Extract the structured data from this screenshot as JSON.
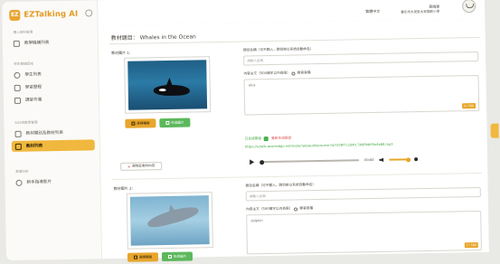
{
  "app": {
    "name": "EZTalking AI",
    "logo_text": "EZ"
  },
  "sidebar": {
    "sections": [
      {
        "title": "個人資料管理",
        "items": [
          {
            "label": "教學機構列表",
            "icon": "home-icon"
          }
        ]
      },
      {
        "title": "學生管理區域",
        "items": [
          {
            "label": "學生列表",
            "icon": "user-icon"
          },
          {
            "label": "學習歷程",
            "icon": "book-icon"
          },
          {
            "label": "課堂作業",
            "icon": "edit-icon"
          }
        ]
      },
      {
        "title": "AI口說教學管理",
        "items": [
          {
            "label": "教材類別及教材列表",
            "icon": "list-icon"
          },
          {
            "label": "教材列表",
            "icon": "document-icon"
          }
        ]
      },
      {
        "title": "數據分析",
        "items": [
          {
            "label": "新手指導影片",
            "icon": "trend-icon"
          }
        ]
      }
    ],
    "active_label": "教材列表",
    "accent": "#f0b83e"
  },
  "topbar": {
    "language": "繁體中文",
    "user_name": "黃曉雯",
    "user_school": "臺北市大安區大安國民小學"
  },
  "main": {
    "breadcrumb": "教材題目：  Whales in the Ocean",
    "items": [
      {
        "pic_label": "教材圖片 1：",
        "upload_label": "選擇檔案",
        "generate_label": "生成圖片",
        "name_label": "題目名稱（可不輸入，題目將以系統自動命名）",
        "name_placeholder": "請輸入名稱",
        "content_label": "內容主文（500個字以內為限）",
        "record_label": "錄音音檔",
        "content_value": "orca",
        "counter": "4 / 500"
      },
      {
        "pic_label": "教材圖片 2：",
        "upload_label": "選擇檔案",
        "generate_label": "生成圖片",
        "name_label": "題目名稱（可不輸入，題目將以系統自動命名）",
        "name_placeholder": "請輸入名稱",
        "content_label": "內容主文（500個字以內為限）",
        "record_label": "錄音音檔",
        "content_value": "dolphin",
        "counter": "7 / 500"
      }
    ],
    "audio": {
      "status_generated": "已生成語音",
      "status_regen": "重新生成語音",
      "url": "https://eztalk.azureedge.net/materials/audio/course-0a7258f7c2d49_5b8f9d6f3e4a88.mp3",
      "time": "00:00"
    },
    "delete_label": "刪除此教材內容"
  },
  "colors": {
    "accent": "#f0b83e",
    "green": "#5cb85c",
    "danger": "#d9534f"
  }
}
